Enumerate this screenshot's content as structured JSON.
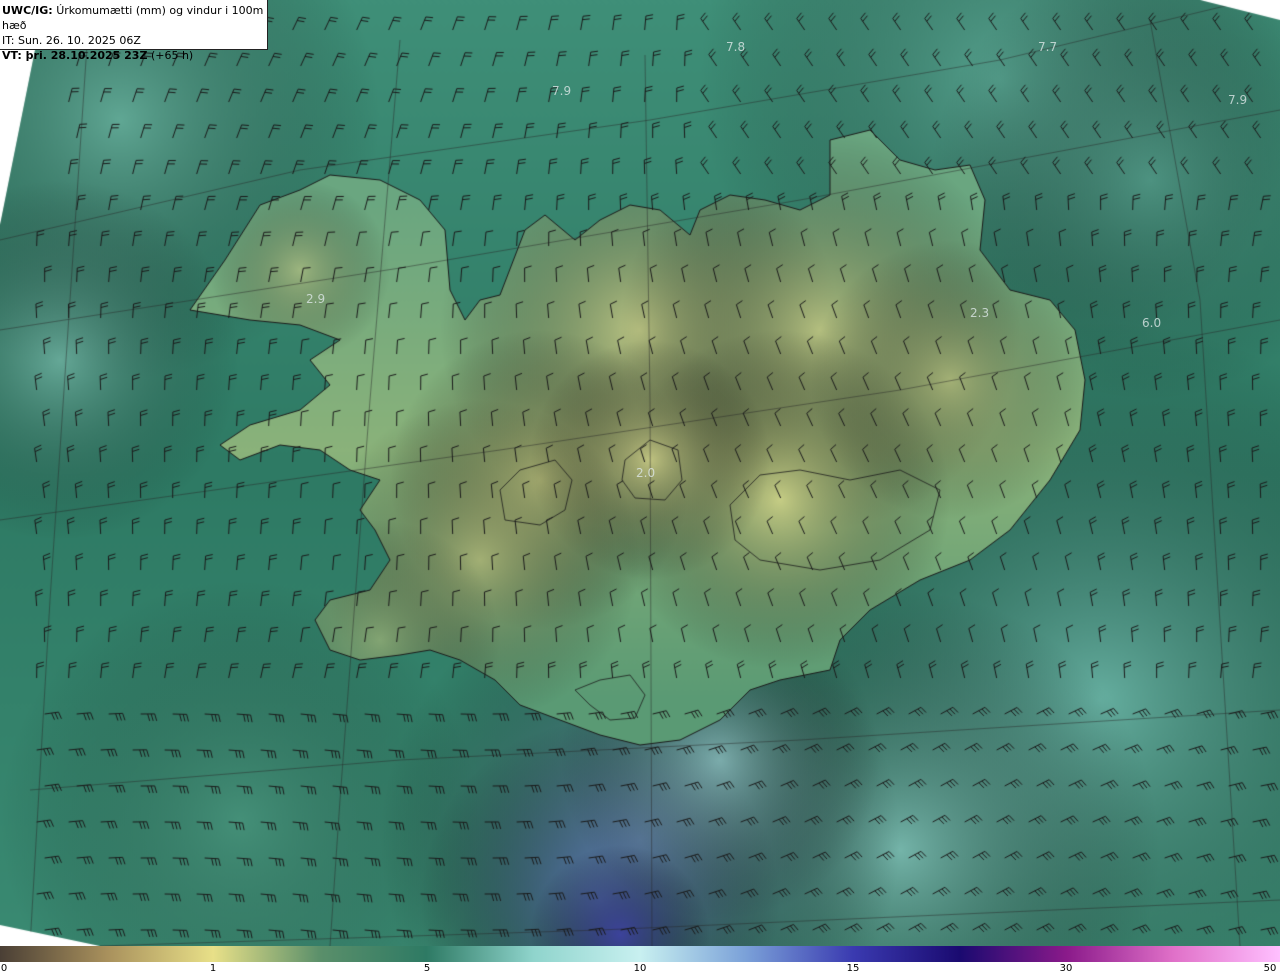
{
  "header": {
    "model": "UWC/IG:",
    "description": "Úrkomumætti (mm) og vindur i 100m hæð",
    "init_time": "IT: Sun. 26. 10. 2025 06Z",
    "valid_label": "VT: þri. 28.10.2025 23Z",
    "lead_time": "(+65 h)"
  },
  "value_labels": [
    "7.8",
    "7.7",
    "7.9",
    "7.9",
    "2.9",
    "2.3",
    "6.0",
    "2.0"
  ],
  "colorbar": {
    "ticks": [
      "0",
      "1",
      "5",
      "10",
      "15",
      "30",
      "50"
    ],
    "colors": [
      "#4a3f35",
      "#a8905c",
      "#e8e088",
      "#5a8f6a",
      "#2e7a64",
      "#8fd4cc",
      "#c8f0f0",
      "#7aa0d8",
      "#3a3ab0",
      "#1a0a70",
      "#8a1a8a",
      "#e070c8",
      "#ffc0ff"
    ]
  },
  "map_colors": {
    "sea_deep": "#2e7a64",
    "sea_light": "#8fd4cc",
    "land_low": "#4a9070",
    "land_high": "#d8d488",
    "rain_blue": "#7aa0d8",
    "coast_line": "#1a1a1a",
    "barb_color": "#1a1a1a"
  }
}
